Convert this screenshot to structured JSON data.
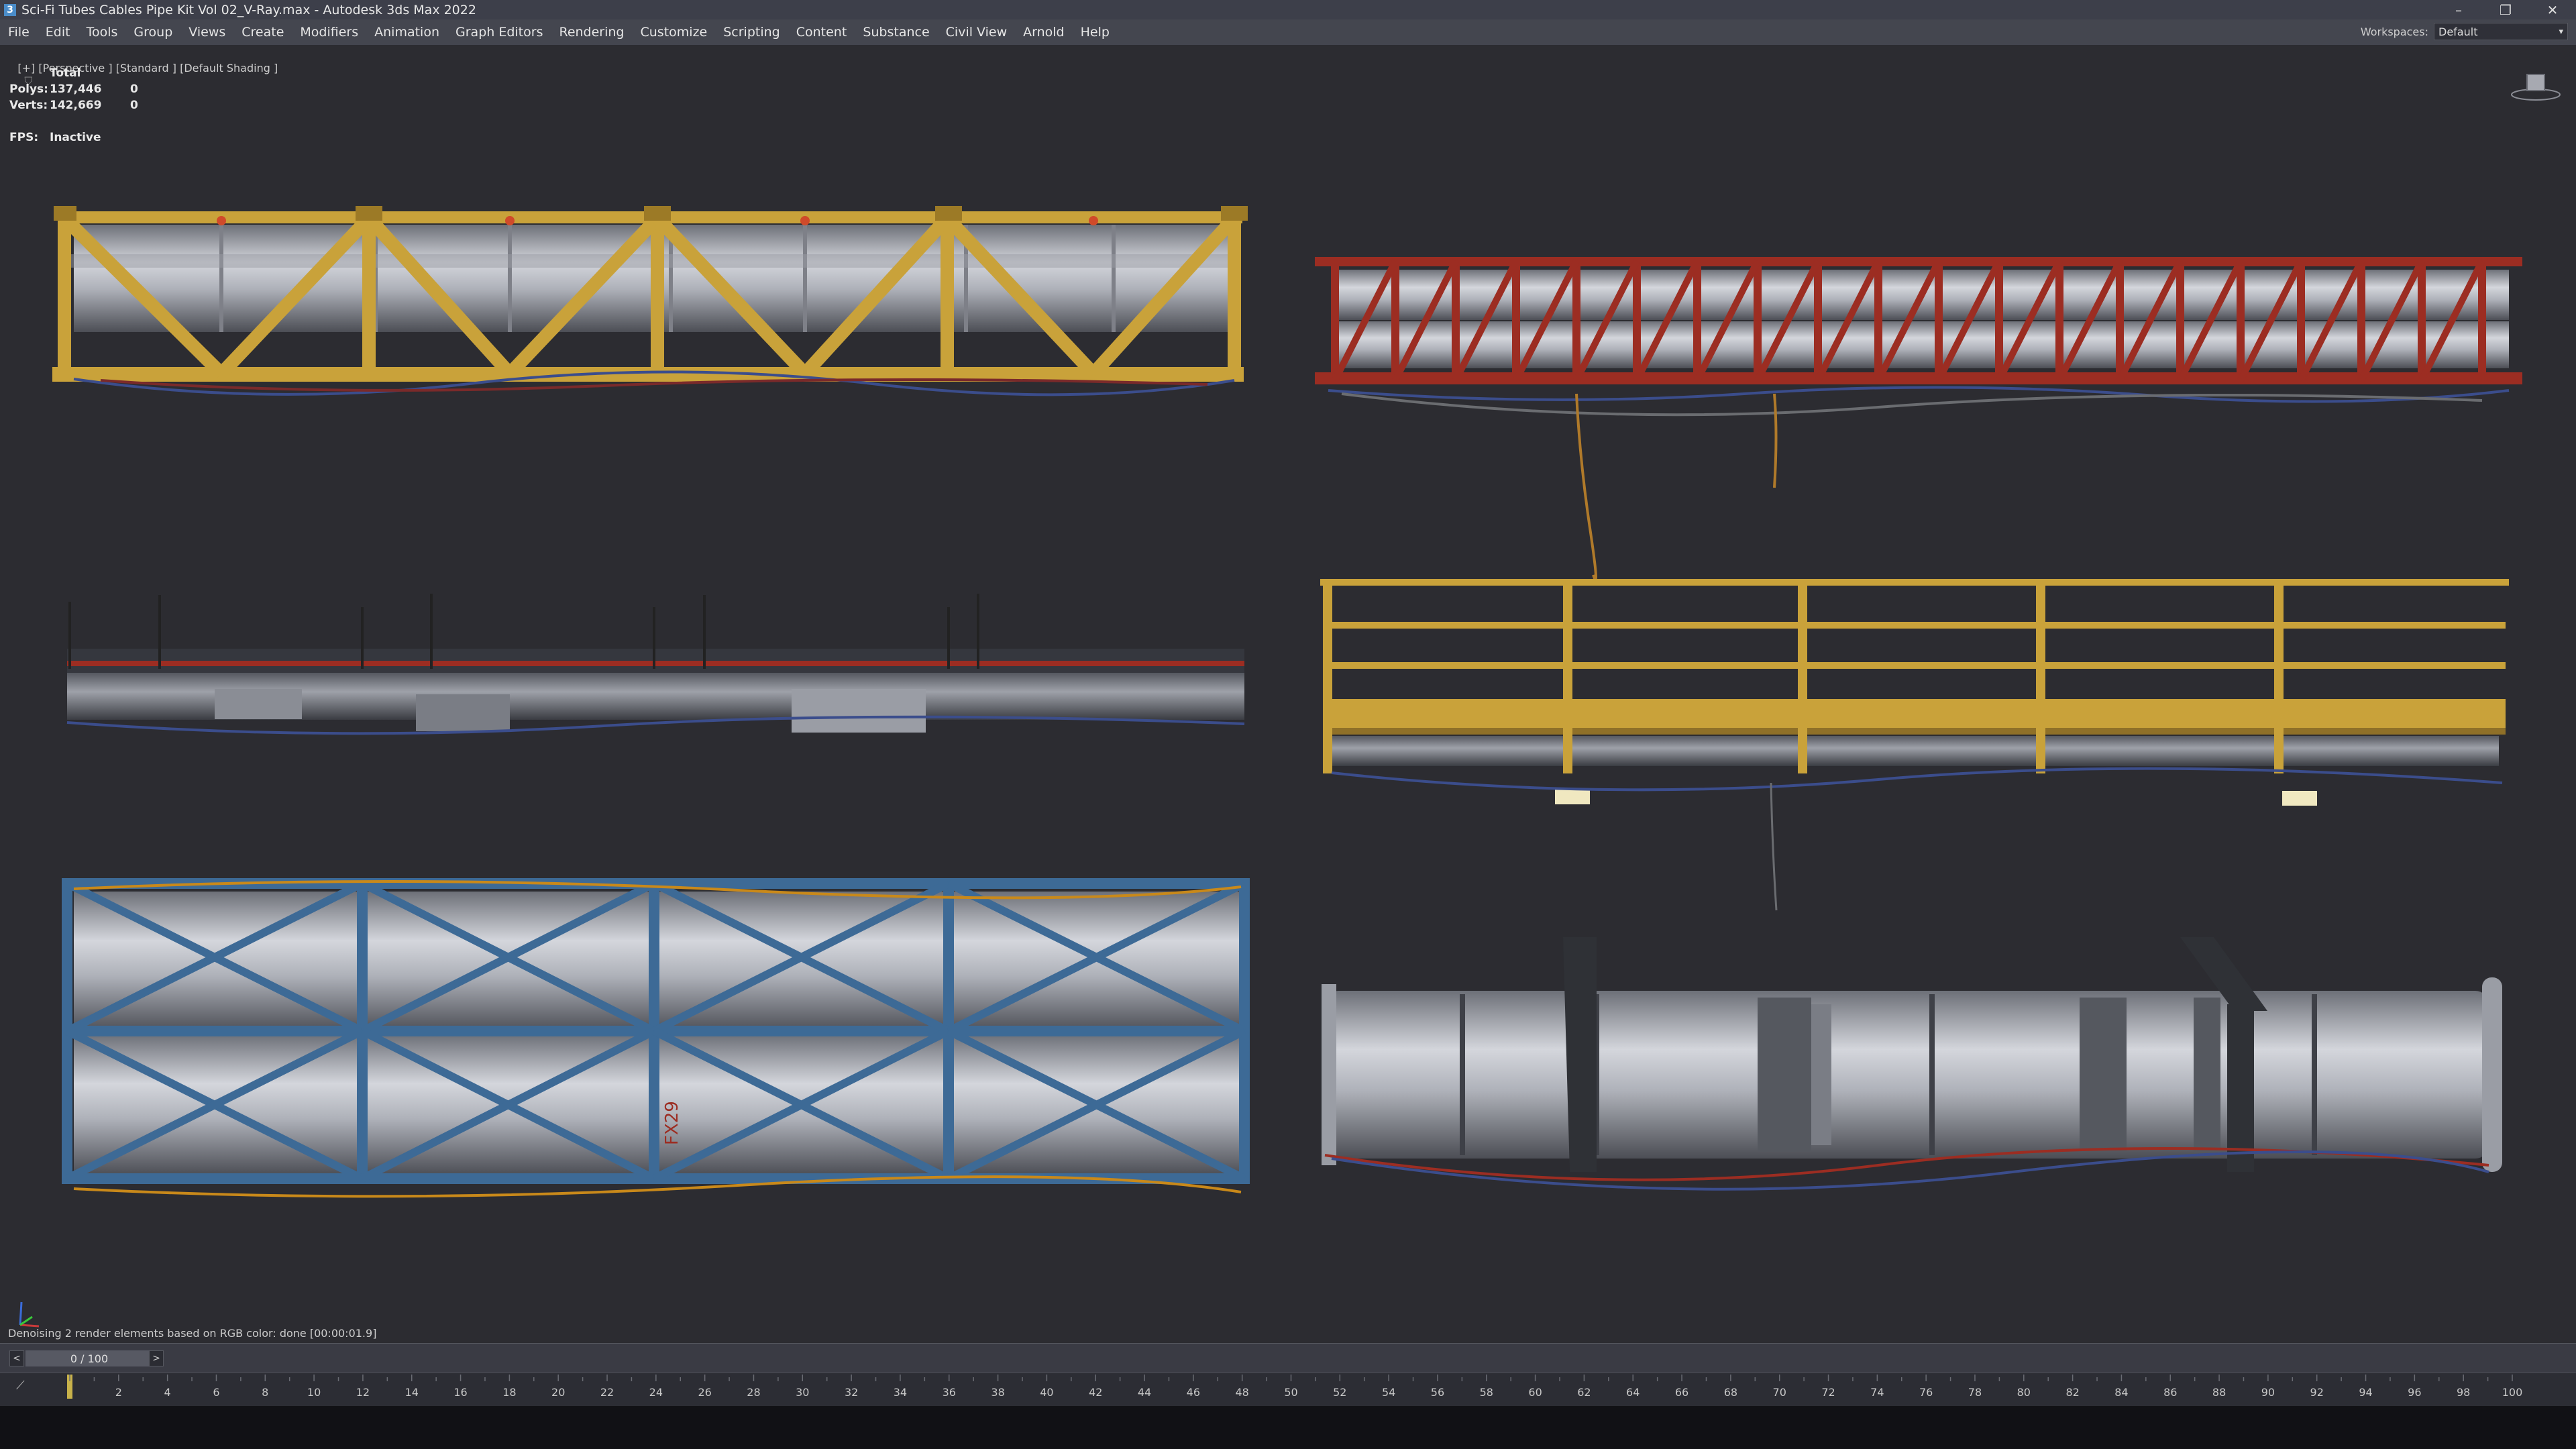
{
  "window": {
    "title": "Sci-Fi Tubes Cables Pipe Kit Vol 02_V-Ray.max - Autodesk 3ds Max 2022",
    "app_icon": "3",
    "controls": [
      "–",
      "❐",
      "✕"
    ]
  },
  "menu": {
    "items": [
      "File",
      "Edit",
      "Tools",
      "Group",
      "Views",
      "Create",
      "Modifiers",
      "Animation",
      "Graph Editors",
      "Rendering",
      "Customize",
      "Scripting",
      "Content",
      "Substance",
      "Civil View",
      "Arnold",
      "Help"
    ],
    "workspaces_label": "Workspaces:",
    "workspaces_value": "Default"
  },
  "viewport": {
    "label": "[+] [Perspective ] [Standard ] [Default Shading ]",
    "filter_icon": "funnel-icon",
    "stats": {
      "header": "Total",
      "polys_label": "Polys:",
      "polys_value": "137,446",
      "polys_sel": "0",
      "verts_label": "Verts:",
      "verts_value": "142,669",
      "verts_sel": "0"
    },
    "fps_label": "FPS:",
    "fps_value": "Inactive",
    "fx_label": "FX29",
    "colors": {
      "yellow": "#c9a23a",
      "red": "#9c2d22",
      "blue": "#3d6a96",
      "pipe": "#b9bcc4"
    }
  },
  "status": {
    "message": "Denoising 2 render elements based on RGB color: done [00:00:01.9]"
  },
  "timeline": {
    "prev": "<",
    "next": ">",
    "frame_display": "0 / 100",
    "ticks": [
      "2",
      "4",
      "6",
      "8",
      "10",
      "12",
      "14",
      "16",
      "18",
      "20",
      "22",
      "24",
      "26",
      "28",
      "30",
      "32",
      "34",
      "36",
      "38",
      "40",
      "42",
      "44",
      "46",
      "48",
      "50",
      "52",
      "54",
      "56",
      "58",
      "60",
      "62",
      "64",
      "66",
      "68",
      "70",
      "72",
      "74",
      "76",
      "78",
      "80",
      "82",
      "84",
      "86",
      "88",
      "90",
      "92",
      "94",
      "96",
      "98",
      "100"
    ]
  }
}
